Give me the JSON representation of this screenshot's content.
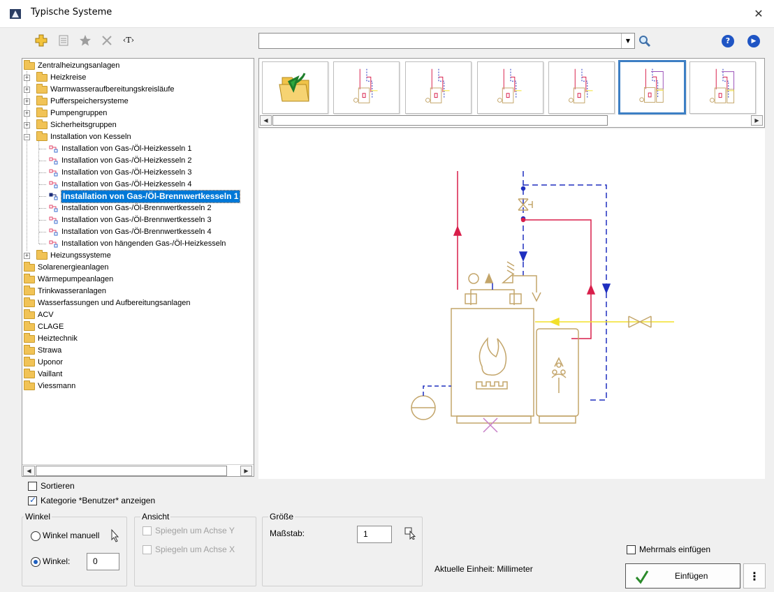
{
  "window": {
    "title": "Typische Systeme"
  },
  "toolbar": {
    "text_tool_label": "‹T›"
  },
  "search": {
    "value": "",
    "placeholder": ""
  },
  "tree": {
    "root": "Zentralheizungsanlagen",
    "items": [
      "Heizkreise",
      "Warmwasseraufbereitungskreisläufe",
      "Pufferspeichersysteme",
      "Pumpengruppen",
      "Sicherheitsgruppen",
      "Installation von Kesseln",
      "Installation von Gas-/Öl-Heizkesseln 1",
      "Installation von Gas-/Öl-Heizkesseln 2",
      "Installation von Gas-/Öl-Heizkesseln 3",
      "Installation von Gas-/Öl-Heizkesseln 4",
      "Installation von Gas-/Öl-Brennwertkesseln 1",
      "Installation von Gas-/Öl-Brennwertkesseln 2",
      "Installation von Gas-/Öl-Brennwertkesseln 3",
      "Installation von Gas-/Öl-Brennwertkesseln 4",
      "Installation von hängenden Gas-/Öl-Heizkesseln",
      "Heizungssysteme",
      "Solarenergieanlagen",
      "Wärmepumpeanlagen",
      "Trinkwasseranlagen",
      "Wasserfassungen und Aufbereitungsanlagen",
      "ACV",
      "CLAGE",
      "Heiztechnik",
      "Strawa",
      "Uponor",
      "Vaillant",
      "Viessmann"
    ],
    "selected_index": 10
  },
  "options": {
    "sort_label": "Sortieren",
    "sort_checked": false,
    "show_user_category_label": "Kategorie *Benutzer* anzeigen",
    "show_user_category_checked": true
  },
  "angle": {
    "group_title": "Winkel",
    "manual_label": "Winkel manuell",
    "angle_label": "Winkel:",
    "angle_value": "0",
    "selected": "angle"
  },
  "view": {
    "group_title": "Ansicht",
    "mirror_y_label": "Spiegeln um Achse Y",
    "mirror_x_label": "Spiegeln um Achse X"
  },
  "size": {
    "group_title": "Größe",
    "scale_label": "Maßstab:",
    "scale_value": "1"
  },
  "footer": {
    "unit_text": "Aktuelle Einheit: Millimeter",
    "insert_multiple_label": "Mehrmals einfügen",
    "insert_button_label": "Einfügen",
    "more_button_label": "⋮"
  },
  "colors": {
    "selection": "#0078d7",
    "pipe_red": "#d81e4a",
    "pipe_blue": "#1f2fbf",
    "pipe_yellow": "#f2e02a",
    "equipment": "#c3a56a",
    "accent": "#1f55c4"
  },
  "icons": {
    "app": "app-logo-icon",
    "add": "add-icon",
    "list": "list-icon",
    "favorite": "star-icon",
    "delete": "delete-icon",
    "text": "text-tool-icon",
    "search": "search-icon",
    "help": "help-icon",
    "info": "info-icon",
    "close": "close-icon"
  }
}
